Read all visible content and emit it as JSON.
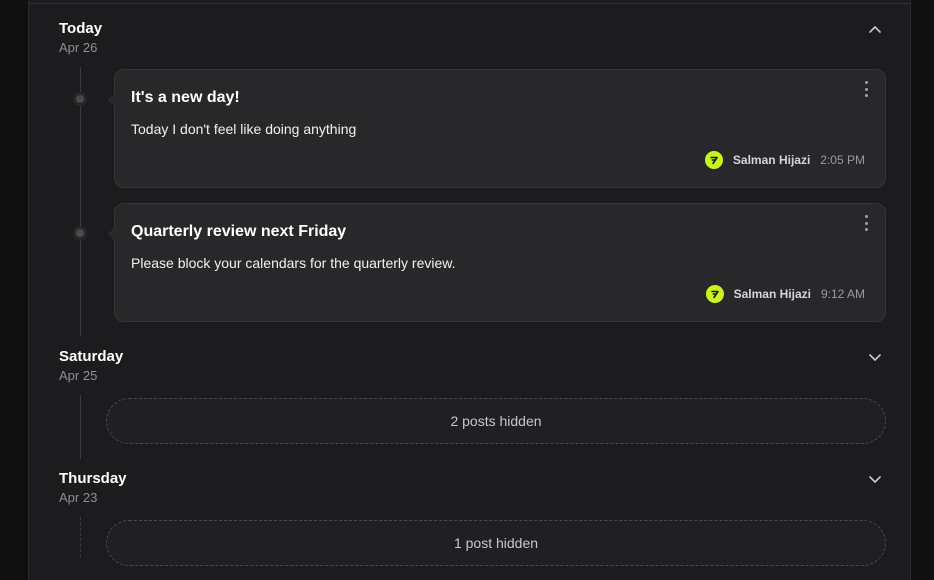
{
  "days": [
    {
      "title": "Today",
      "date": "Apr 26",
      "expanded": true,
      "posts": [
        {
          "title": "It's a new day!",
          "body": "Today I don't feel like doing anything",
          "author": "Salman Hijazi",
          "time": "2:05 PM"
        },
        {
          "title": "Quarterly review next Friday",
          "body": "Please block your calendars for the quarterly review.",
          "author": "Salman Hijazi",
          "time": "9:12 AM"
        }
      ]
    },
    {
      "title": "Saturday",
      "date": "Apr 25",
      "expanded": false,
      "hidden_label": "2 posts hidden"
    },
    {
      "title": "Thursday",
      "date": "Apr 23",
      "expanded": false,
      "hidden_label": "1 post hidden"
    }
  ],
  "icons": {
    "collapse": "chevron-up-icon",
    "expand": "chevron-down-icon",
    "menu": "more-vertical-icon"
  },
  "colors": {
    "avatar_accent": "#c8f31d",
    "panel_bg": "#1c1c1e",
    "card_bg": "#28282a"
  }
}
